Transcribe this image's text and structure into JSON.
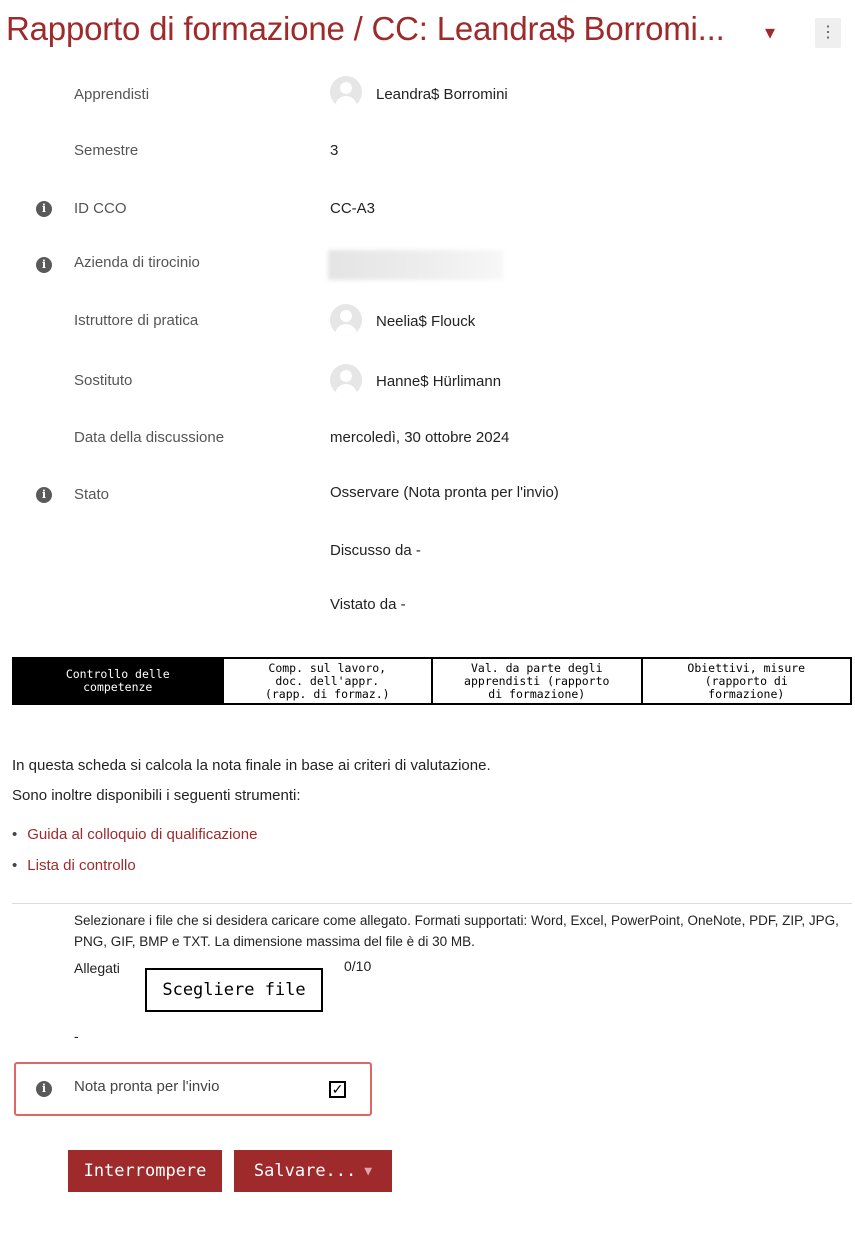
{
  "header": {
    "title": "Rapporto di formazione / CC: Leandra$ Borromi...",
    "caret_icon": "▾",
    "menu_icon": "⋮"
  },
  "fields": {
    "apprendisti": {
      "label": "Apprendisti",
      "value": "Leandra$ Borromini"
    },
    "semestre": {
      "label": "Semestre",
      "value": "3"
    },
    "id_cco": {
      "label": "ID CCO",
      "value": "CC-A3"
    },
    "azienda": {
      "label": "Azienda di tirocinio"
    },
    "istruttore": {
      "label": "Istruttore di pratica",
      "value": "Neelia$ Flouck"
    },
    "sostituto": {
      "label": "Sostituto",
      "value": "Hanne$ Hürlimann"
    },
    "data": {
      "label": "Data della discussione",
      "value": "mercoledì, 30 ottobre 2024"
    },
    "stato": {
      "label": "Stato",
      "value": "Osservare (Nota pronta per l'invio)",
      "discusso": "Discusso da -",
      "vistato": "Vistato da -"
    }
  },
  "tabs": [
    {
      "label": "Controllo delle\ncompetenze",
      "active": true
    },
    {
      "label": "Comp. sul lavoro,\ndoc. dell'appr.\n(rapp. di formaz.)",
      "active": false
    },
    {
      "label": "Val. da parte degli\napprendisti (rapporto\ndi formazione)",
      "active": false
    },
    {
      "label": "Obiettivi, misure\n(rapporto di\nformazione)",
      "active": false
    }
  ],
  "content": {
    "intro_1": "In questa scheda si calcola la nota finale in base ai criteri di valutazione.",
    "intro_2": "Sono inoltre disponibili i seguenti strumenti:",
    "links": [
      "Guida al colloquio di qualificazione",
      "Lista di controllo"
    ]
  },
  "attachments": {
    "help": "Selezionare i file che si desidera caricare come allegato. Formati supportati: Word, Excel, PowerPoint, OneNote, PDF, ZIP, JPG, PNG, GIF, BMP e TXT. La dimensione massima del file è di 30 MB.",
    "label": "Allegati",
    "button": "Scegliere file",
    "count": "0/10",
    "empty": "-"
  },
  "ready": {
    "label": "Nota pronta per l'invio",
    "checked": true,
    "check_glyph": "✓"
  },
  "actions": {
    "cancel": "Interrompere",
    "save": "Salvare...",
    "save_caret": "▼"
  },
  "colors": {
    "brand": "#9e2a2b",
    "highlight": "#e06666"
  }
}
